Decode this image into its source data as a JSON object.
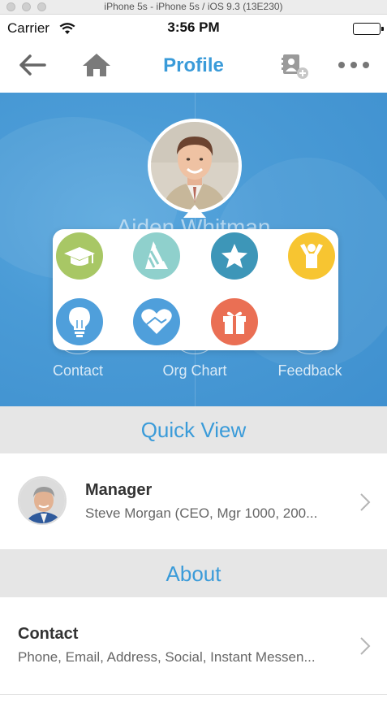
{
  "simulator": {
    "title": "iPhone 5s - iPhone 5s / iOS 9.3 (13E230)"
  },
  "status_bar": {
    "carrier": "Carrier",
    "time": "3:56 PM"
  },
  "nav": {
    "title": "Profile",
    "icons": {
      "back": "back-arrow-icon",
      "home": "home-icon",
      "contact": "contact-card-icon",
      "more": "more-dots-icon"
    }
  },
  "hero": {
    "name_partial": "Aiden Whitman",
    "actions": [
      {
        "label": "Contact"
      },
      {
        "label": "Org Chart"
      },
      {
        "label": "Feedback"
      }
    ]
  },
  "popup": {
    "badges": [
      {
        "icon": "graduation-cap-icon",
        "color": "#a8c765"
      },
      {
        "icon": "party-hat-icon",
        "color": "#8fd0cc"
      },
      {
        "icon": "star-icon",
        "color": "#3d96b8"
      },
      {
        "icon": "celebrating-person-icon",
        "color": "#f7c531"
      },
      {
        "icon": "lightbulb-icon",
        "color": "#4f9fdb"
      },
      {
        "icon": "handshake-heart-icon",
        "color": "#4f9fdb"
      },
      {
        "icon": "gift-icon",
        "color": "#ea6f54"
      }
    ]
  },
  "sections": {
    "quick_view": "Quick View",
    "about": "About"
  },
  "manager_row": {
    "title": "Manager",
    "subtitle": "Steve Morgan (CEO, Mgr 1000, 200..."
  },
  "contact_row": {
    "title": "Contact",
    "subtitle": "Phone, Email, Address, Social, Instant Messen..."
  },
  "colors": {
    "accent": "#3a9bd9",
    "hero_bg": "#4a9bd6",
    "section_bg": "#e6e6e6"
  }
}
